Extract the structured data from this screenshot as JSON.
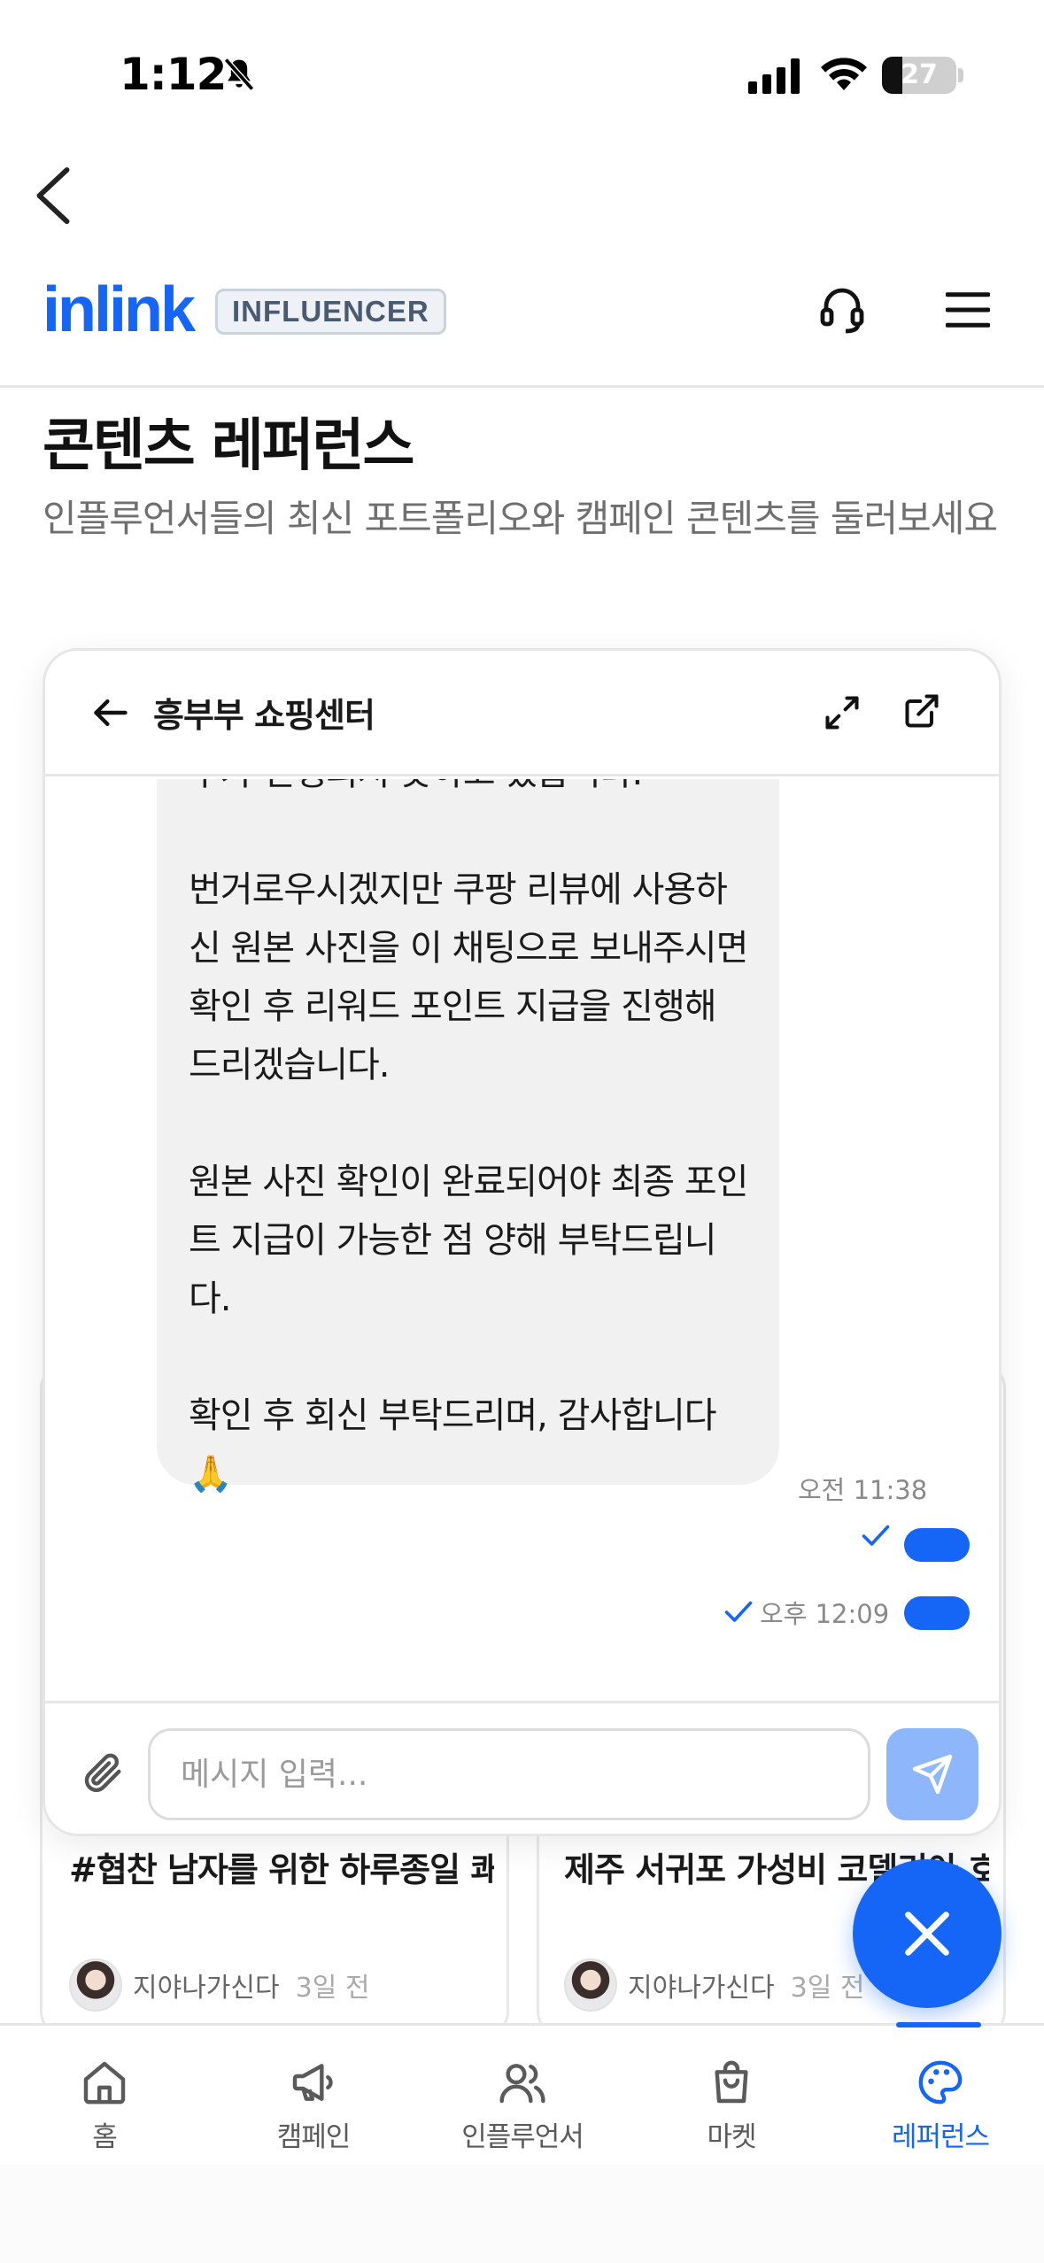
{
  "status_bar": {
    "time": "1:12",
    "battery": "27",
    "battery_level": 0.27
  },
  "header": {
    "logo": "inlink",
    "badge": "INFLUENCER"
  },
  "page": {
    "title": "콘텐츠 레퍼런스",
    "subtitle": "인플루언서들의 최신 포트폴리오와 캠페인 콘텐츠를 둘러보세요"
  },
  "chat": {
    "title": "흥부부 쇼핑센터",
    "message_text": "추가 진행되지 못하고 있습니다.\n\n번거로우시겠지만 쿠팡 리뷰에 사용하신 원본 사진을 이 채팅으로 보내주시면 확인 후 리워드 포인트 지급을 진행해 드리겠습니다.\n\n원본 사진 확인이 완료되어야 최종 포인트 지급이 가능한 점 양해 부탁드립니다.\n\n확인 후 회신 부탁드리며, 감사합니다 🙏",
    "message_time": "오전 11:38",
    "sent_time": "오후 12:09",
    "input_placeholder": "메시지 입력..."
  },
  "cards": [
    {
      "title": "#협찬 남자를 위한 하루종일 쾌적한 이너쉴드 본 심리스...",
      "author": "지야나가신다",
      "time": "3일 전"
    },
    {
      "title": "제주 서귀포 가성비 코델리아 호텔 직거래 예약",
      "author": "지야나가신다",
      "time": "3일 전"
    }
  ],
  "nav": {
    "items": [
      {
        "label": "홈",
        "icon": "home-icon"
      },
      {
        "label": "캠페인",
        "icon": "megaphone-icon"
      },
      {
        "label": "인플루언서",
        "icon": "users-icon"
      },
      {
        "label": "마켓",
        "icon": "shopping-bag-icon"
      },
      {
        "label": "레퍼런스",
        "icon": "palette-icon"
      }
    ],
    "active_index": 4
  },
  "colors": {
    "accent": "#1565f6",
    "send_button": "#8db6fb"
  }
}
